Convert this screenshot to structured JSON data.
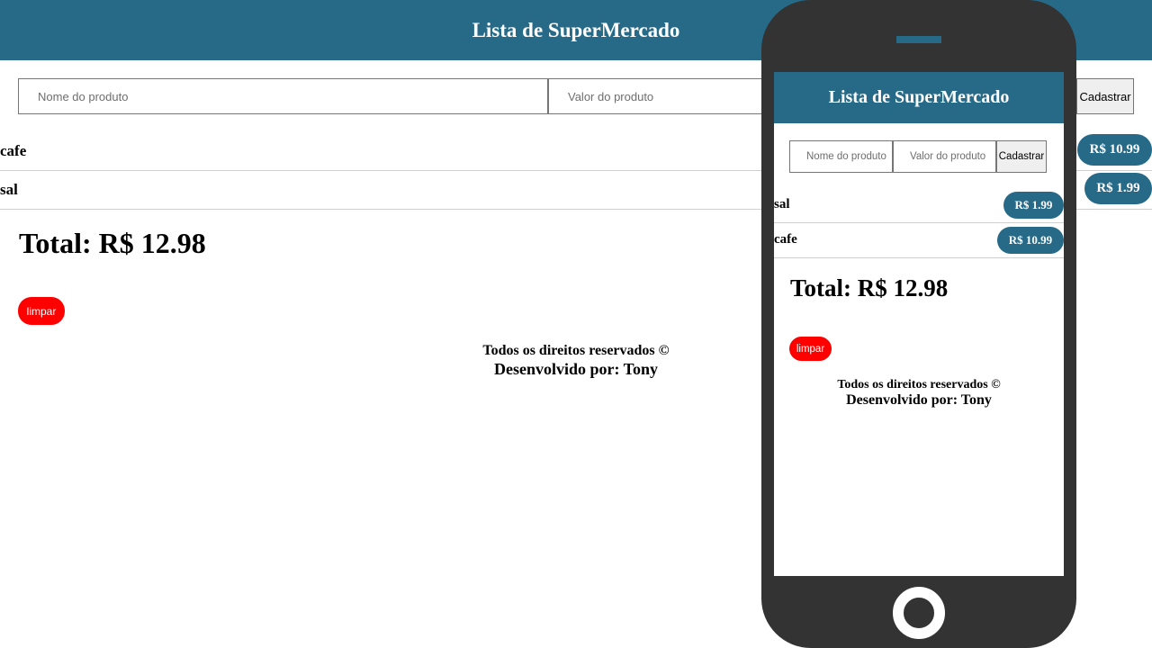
{
  "desktop": {
    "header": {
      "title": "Lista de SuperMercado"
    },
    "form": {
      "name_placeholder": "Nome do produto",
      "value_placeholder": "Valor do produto",
      "submit_label": "Cadastrar"
    },
    "items": [
      {
        "name": "cafe",
        "price": "R$ 10.99"
      },
      {
        "name": "sal",
        "price": "R$ 1.99"
      }
    ],
    "total": "Total: R$ 12.98",
    "clear_label": "limpar",
    "footer": {
      "rights": "Todos os direitos reservados ©",
      "developer": "Desenvolvido por: Tony"
    }
  },
  "mobile": {
    "header": {
      "title": "Lista de SuperMercado"
    },
    "form": {
      "name_placeholder": "Nome do produto",
      "value_placeholder": "Valor do produto",
      "submit_label": "Cadastrar"
    },
    "items": [
      {
        "name": "sal",
        "price": "R$ 1.99"
      },
      {
        "name": "cafe",
        "price": "R$ 10.99"
      }
    ],
    "total": "Total: R$ 12.98",
    "clear_label": "limpar",
    "footer": {
      "rights": "Todos os direitos reservados ©",
      "developer": "Desenvolvido por: Tony"
    }
  },
  "colors": {
    "header_bg": "#276a88",
    "price_pill": "#276a88",
    "clear_button": "#ff0000",
    "phone_frame": "#333333"
  }
}
